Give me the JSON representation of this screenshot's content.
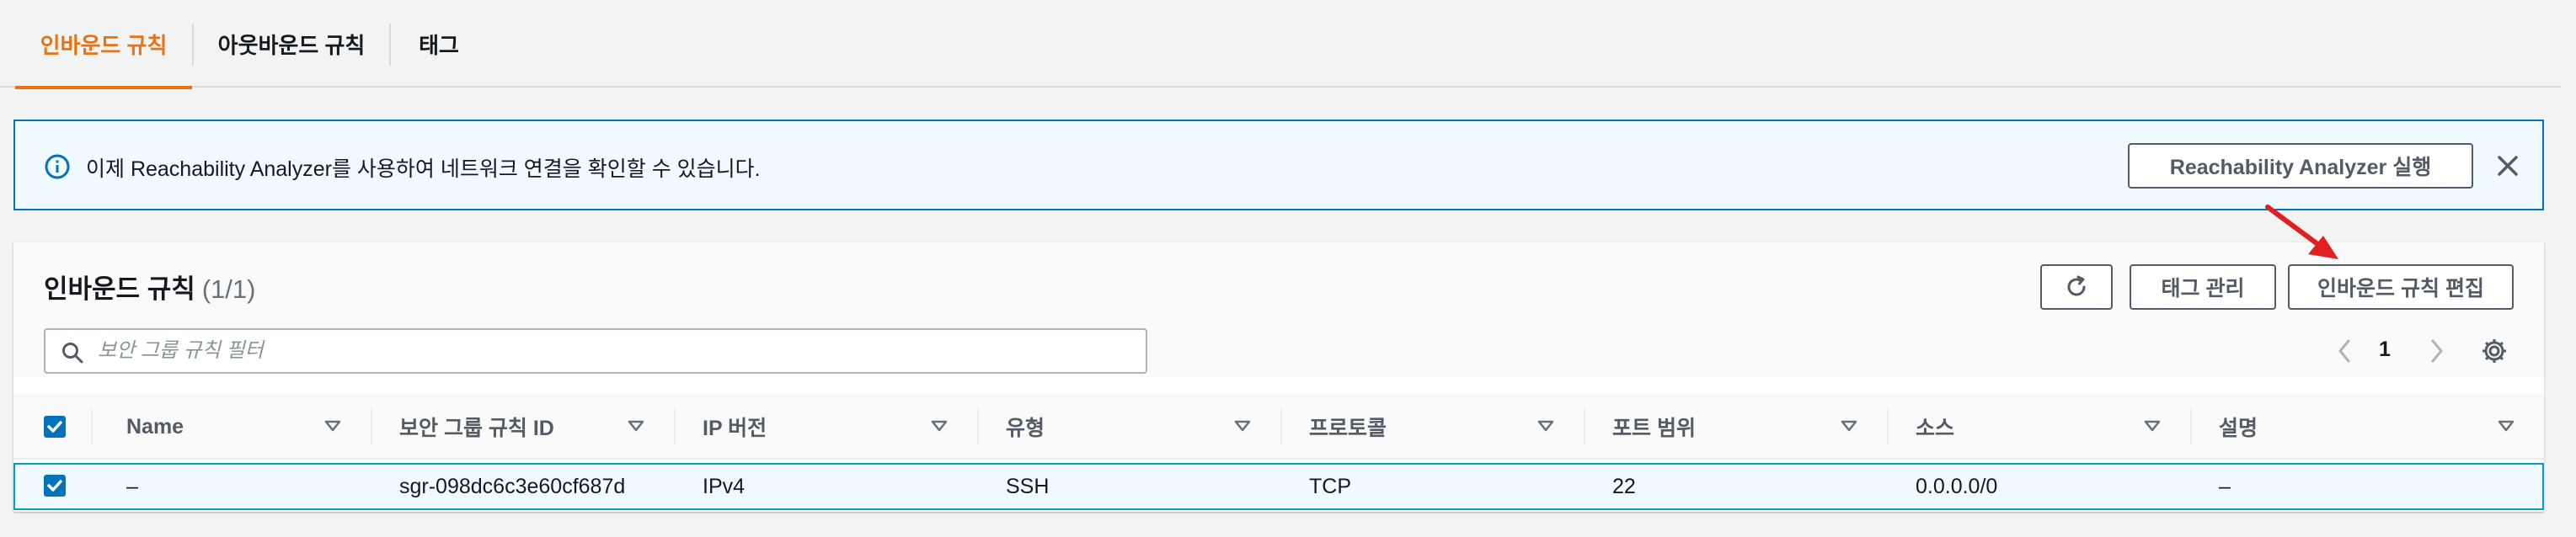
{
  "tabs": [
    {
      "label": "인바운드 규칙",
      "active": true
    },
    {
      "label": "아웃바운드 규칙",
      "active": false
    },
    {
      "label": "태그",
      "active": false
    }
  ],
  "flash": {
    "icon": "info-icon",
    "message": "이제 Reachability Analyzer를 사용하여 네트워크 연결을 확인할 수 있습니다.",
    "action_label": "Reachability Analyzer 실행",
    "close_icon": "close-icon"
  },
  "panel": {
    "title": "인바운드 규칙",
    "count": "(1/1)",
    "refresh_icon": "refresh-icon",
    "manage_tags_label": "태그 관리",
    "edit_rules_label": "인바운드 규칙 편집",
    "search_placeholder": "보안 그룹 규칙 필터",
    "search_value": "",
    "pagination": {
      "current_page": "1"
    },
    "settings_icon": "gear-icon"
  },
  "table": {
    "select_all_checked": true,
    "columns": [
      "Name",
      "보안 그룹 규칙 ID",
      "IP 버전",
      "유형",
      "프로토콜",
      "포트 범위",
      "소스",
      "설명"
    ],
    "rows": [
      {
        "selected": true,
        "cells": [
          "–",
          "sgr-098dc6c3e60cf687d",
          "IPv4",
          "SSH",
          "TCP",
          "22",
          "0.0.0.0/0",
          "–"
        ]
      }
    ]
  },
  "colors": {
    "accent_orange": "#ec7211",
    "info_blue": "#0073bb",
    "annotation_red": "#e02020"
  }
}
